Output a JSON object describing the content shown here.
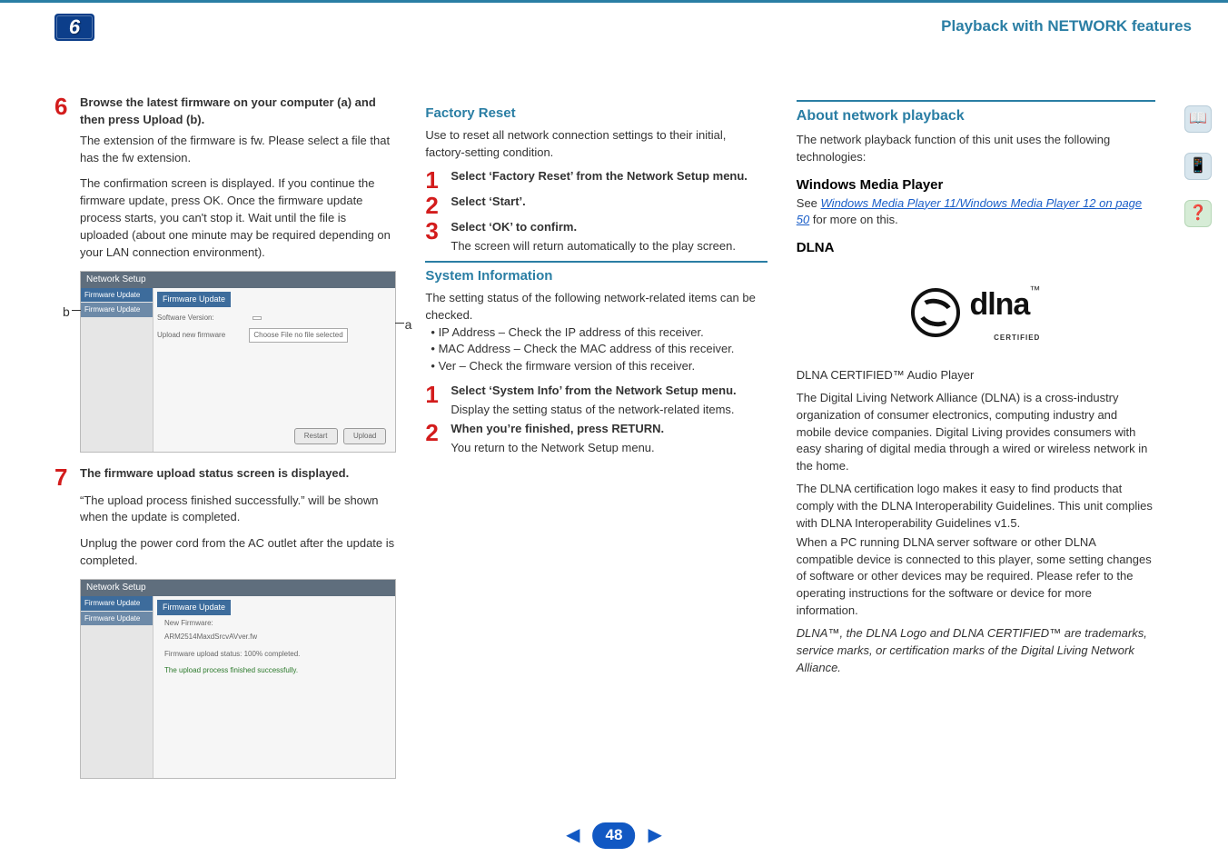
{
  "header": {
    "chapter_number": "6",
    "section_title": "Playback with NETWORK features"
  },
  "col1": {
    "step6": {
      "num": "6",
      "head": "Browse the latest firmware on your computer (a) and then press Upload (b).",
      "p1": "The extension of the firmware is fw. Please select a file that has the fw extension.",
      "p2": "The confirmation screen is displayed. If you continue the firmware update, press OK. Once the firmware update process starts, you can't stop it. Wait until the file is uploaded (about one minute may be required depending on your LAN connection environment)."
    },
    "ss1": {
      "title": "Network Setup",
      "side1": "Firmware Update",
      "side2": "Firmware Update",
      "tab": "Firmware Update",
      "line1_label": "Software Version:",
      "line1_value": "",
      "line2_label": "Upload new firmware",
      "line2_btn": "Choose File",
      "line2_txt": "no file selected",
      "btn_restart": "Restart",
      "btn_upload": "Upload",
      "label_a": "a",
      "label_b": "b"
    },
    "step7": {
      "num": "7",
      "head": "The firmware upload status screen is displayed.",
      "p1": "“The upload process finished successfully.” will be shown when the update is completed.",
      "p2": "Unplug the power cord from the AC outlet after the update is completed."
    },
    "ss2": {
      "title": "Network Setup",
      "side1": "Firmware Update",
      "side2": "Firmware Update",
      "tab": "Firmware Update",
      "l1": "New Firmware:",
      "l2": "ARM2514MaxdSrcvAVver.fw",
      "l3": "Firmware upload status: 100% completed.",
      "l4": "The upload process finished successfully."
    }
  },
  "col2": {
    "factory": {
      "title": "Factory Reset",
      "intro": "Use to reset all network connection settings to their initial, factory-setting condition.",
      "s1_num": "1",
      "s1": "Select ‘Factory Reset’ from the Network Setup menu.",
      "s2_num": "2",
      "s2": "Select ‘Start’.",
      "s3_num": "3",
      "s3": "Select ‘OK’ to confirm.",
      "s3_body": "The screen will return automatically to the play screen."
    },
    "sysinfo": {
      "title": "System Information",
      "intro": "The setting status of the following network-related items can be checked.",
      "b1": "IP Address – Check the IP address of this receiver.",
      "b2": "MAC Address – Check the MAC address of this receiver.",
      "b3": "Ver – Check the firmware version of this receiver.",
      "s1_num": "1",
      "s1": "Select ‘System Info’ from the Network Setup menu.",
      "s1_body": "Display the setting status of the network-related items.",
      "s2_num": "2",
      "s2_a": "When you’re finished, press ",
      "s2_b": "RETURN",
      "s2_c": ".",
      "s2_body": "You return to the Network Setup menu."
    }
  },
  "col3": {
    "about": {
      "title": "About network playback",
      "intro": "The network playback function of this unit uses the following technologies:"
    },
    "wmp": {
      "title": "Windows Media Player",
      "pre": "See ",
      "link": "Windows Media Player 11/Windows Media Player 12",
      "mid": " on ",
      "link2": "page 50",
      "post": " for more on this."
    },
    "dlna": {
      "title": "DLNA",
      "logo_text": "dlna",
      "logo_cert": "CERTIFIED",
      "tm": "™",
      "subtitle": "DLNA CERTIFIED™ Audio Player",
      "p1": "The Digital Living Network Alliance (DLNA) is a cross-industry organization of consumer electronics, computing industry and mobile device companies. Digital Living provides consumers with easy sharing of digital media through a wired or wireless network in the home.",
      "p2": "The DLNA certification logo makes it easy to find products that comply with the DLNA Interoperability Guidelines. This unit complies with DLNA Interoperability Guidelines v1.5.",
      "p3": "When a PC running DLNA server software or other DLNA compatible device is connected to this player, some setting changes of software or other devices may be required. Please refer to the operating instructions for the software or device for more information.",
      "p4": "DLNA™, the DLNA Logo and DLNA CERTIFIED™ are trademarks, service marks, or certification marks of the Digital Living Network Alliance."
    }
  },
  "footer": {
    "prev": "◀",
    "page": "48",
    "next": "▶"
  },
  "icons": {
    "book": "📖",
    "device": "📱",
    "help": "❓"
  }
}
